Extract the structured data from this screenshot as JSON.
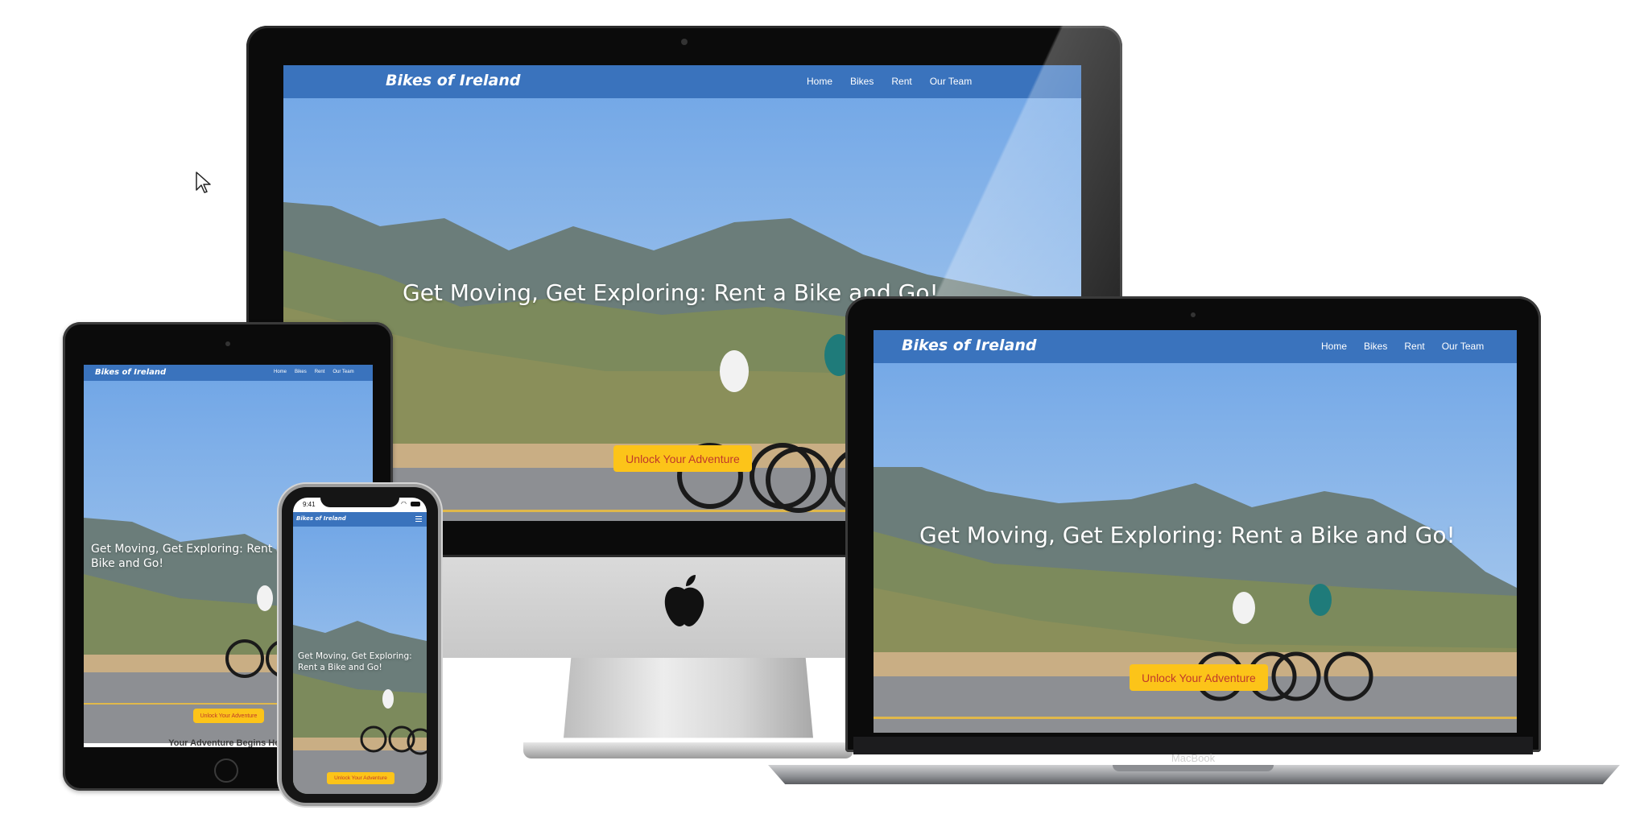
{
  "site": {
    "brand": "Bikes of Ireland",
    "nav": [
      "Home",
      "Bikes",
      "Rent",
      "Our Team"
    ],
    "headline": "Get Moving, Get Exploring: Rent a Bike and Go!",
    "cta": "Unlock Your Adventure"
  },
  "tablet": {
    "headline_visible": "Get Moving, Get Exploring: Rent a Bike and Go!",
    "next_section_heading": "Your Adventure Begins Here"
  },
  "phone": {
    "time": "9:41",
    "menu_icon": "hamburger-icon"
  },
  "laptop": {
    "model_label": "MacBook"
  },
  "colors": {
    "navbar": "#3a73bd",
    "cta_bg": "#fcc419",
    "cta_text": "#c0392b"
  }
}
